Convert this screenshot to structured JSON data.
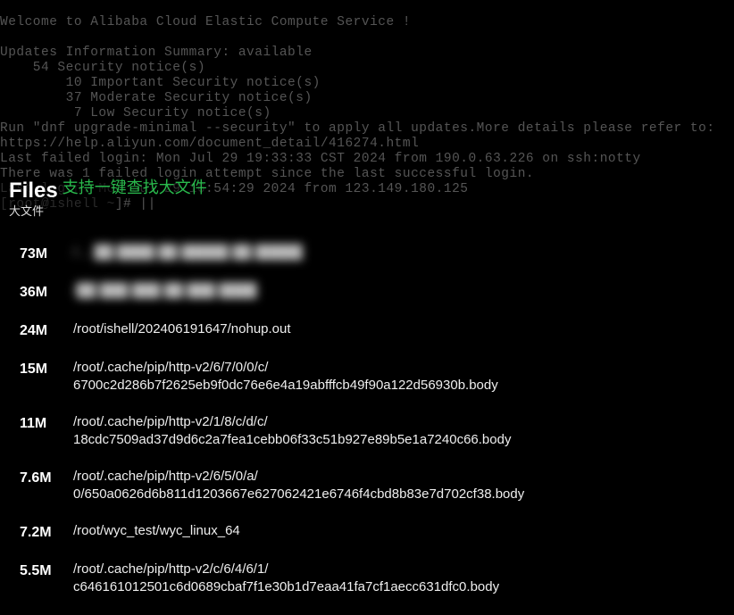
{
  "terminal": {
    "lines": "Welcome to Alibaba Cloud Elastic Compute Service !\n\nUpdates Information Summary: available\n    54 Security notice(s)\n        10 Important Security notice(s)\n        37 Moderate Security notice(s)\n         7 Low Security notice(s)\nRun \"dnf upgrade-minimal --security\" to apply all updates.More details please refer to:\nhttps://help.aliyun.com/document_detail/416274.html\nLast failed login: Mon Jul 29 19:33:33 CST 2024 from 190.0.63.226 on ssh:notty\nThere was 1 failed login attempt since the last successful login.\nLast login: Mon Jul 29 16:54:29 2024 from 123.149.180.125\n[root@ishell ~]# ||"
  },
  "panel": {
    "title": "Files",
    "feature_text": "支持一键查找大文件",
    "sub_label": "大文件"
  },
  "files": [
    {
      "size": "73M",
      "path": "/… ██ ████ ██ █████ ██ █████",
      "blurred": true
    },
    {
      "size": "36M",
      "path": "/██ ███ ███ ██ ███ ████",
      "blurred": true
    },
    {
      "size": "24M",
      "path": "/root/ishell/202406191647/nohup.out",
      "blurred": false
    },
    {
      "size": "15M",
      "path": "/root/.cache/pip/http-v2/6/7/0/0/c/\n6700c2d286b7f2625eb9f0dc76e6e4a19abfffcb49f90a122d56930b.body",
      "blurred": false
    },
    {
      "size": "11M",
      "path": "/root/.cache/pip/http-v2/1/8/c/d/c/\n18cdc7509ad37d9d6c2a7fea1cebb06f33c51b927e89b5e1a7240c66.body",
      "blurred": false
    },
    {
      "size": "7.6M",
      "path": "/root/.cache/pip/http-v2/6/5/0/a/\n0/650a0626d6b811d1203667e627062421e6746f4cbd8b83e7d702cf38.body",
      "blurred": false
    },
    {
      "size": "7.2M",
      "path": "/root/wyc_test/wyc_linux_64",
      "blurred": false
    },
    {
      "size": "5.5M",
      "path": "/root/.cache/pip/http-v2/c/6/4/6/1/\nc646161012501c6d0689cbaf7f1e30b1d7eaa41fa7cf1aecc631dfc0.body",
      "blurred": false
    }
  ]
}
